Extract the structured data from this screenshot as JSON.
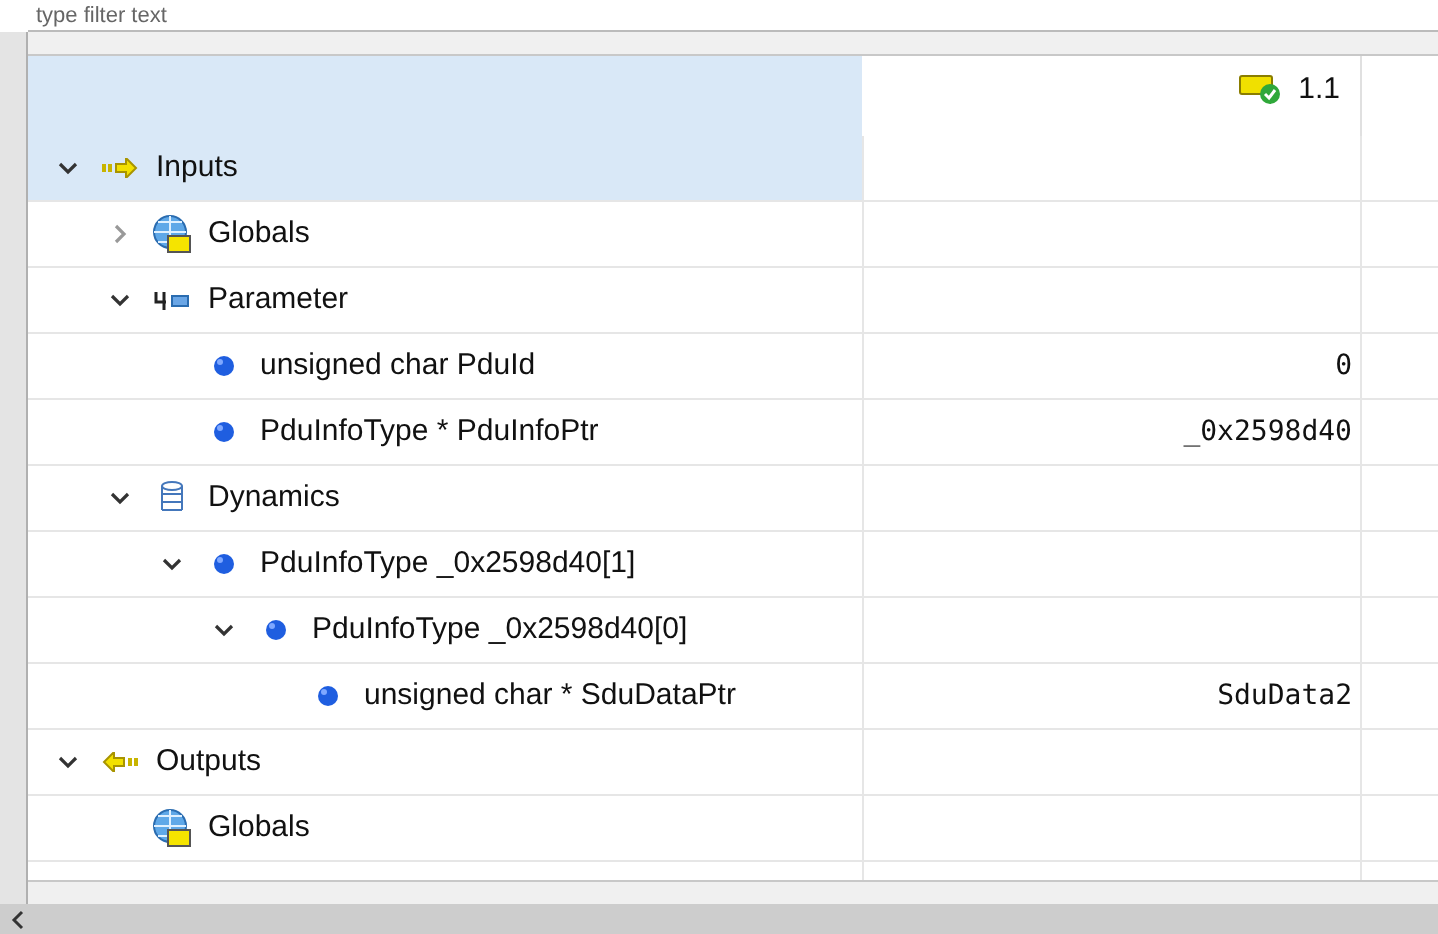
{
  "filter": {
    "placeholder": "type filter text"
  },
  "header": {
    "version": "1.1"
  },
  "tree": [
    {
      "label": "Inputs",
      "kind": "inputs",
      "expanded": true,
      "selected": true,
      "children": [
        {
          "label": "Globals",
          "kind": "globals",
          "expanded": false,
          "selected": false
        },
        {
          "label": "Parameter",
          "kind": "parameter",
          "expanded": true,
          "selected": false,
          "children": [
            {
              "label": "unsigned char PduId",
              "kind": "variable",
              "selected": false,
              "value": "0"
            },
            {
              "label": "PduInfoType * PduInfoPtr",
              "kind": "variable",
              "selected": false,
              "value": "_0x2598d40"
            }
          ]
        },
        {
          "label": "Dynamics",
          "kind": "dynamics",
          "expanded": true,
          "selected": false,
          "children": [
            {
              "label": "PduInfoType _0x2598d40[1]",
              "kind": "variable",
              "expanded": true,
              "selected": false,
              "children": [
                {
                  "label": "PduInfoType  _0x2598d40[0]",
                  "kind": "variable",
                  "expanded": true,
                  "selected": false,
                  "children": [
                    {
                      "label": "unsigned char * SduDataPtr",
                      "kind": "variable",
                      "selected": false,
                      "value": "SduData2"
                    }
                  ]
                }
              ]
            }
          ]
        }
      ]
    },
    {
      "label": "Outputs",
      "kind": "outputs",
      "expanded": true,
      "selected": false,
      "children": [
        {
          "label": "Globals",
          "kind": "globals",
          "selected": false
        }
      ]
    }
  ]
}
